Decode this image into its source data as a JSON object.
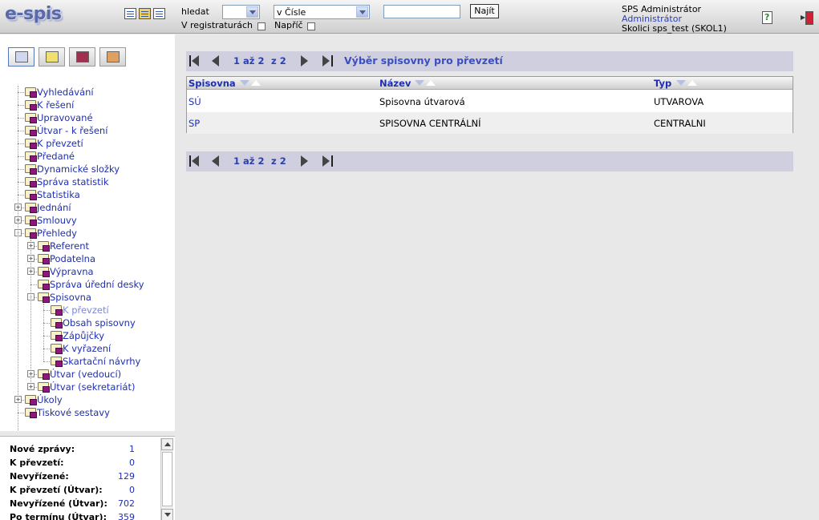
{
  "app": {
    "logo": "e-spis"
  },
  "header": {
    "search_label": "hledat",
    "search_scope_value": "v Čísle",
    "search_type_value": "",
    "search_value": "",
    "search_button": "Najít",
    "in_registers_label": "V registraturách",
    "across_label": "Napříč",
    "user_name": "SPS Administrátor",
    "user_role": "Administrátor",
    "user_training": "Skolici sps_test (SKOL1)",
    "toolbar_icons": [
      "list-icon",
      "form-icon",
      "detail-icon"
    ]
  },
  "left": {
    "tabs": [
      "documents-icon",
      "binder-icon",
      "books-icon",
      "tools-icon"
    ],
    "tree": [
      {
        "label": "Vyhledávání"
      },
      {
        "label": "K řešení"
      },
      {
        "label": "Upravované"
      },
      {
        "label": "Útvar - k řešení"
      },
      {
        "label": "K převzetí"
      },
      {
        "label": "Předané"
      },
      {
        "label": "Dynamické složky"
      },
      {
        "label": "Správa statistik"
      },
      {
        "label": "Statistika"
      },
      {
        "label": "Jednání"
      },
      {
        "label": "Smlouvy"
      },
      {
        "label": "Přehledy"
      },
      {
        "label": "Referent"
      },
      {
        "label": "Podatelna"
      },
      {
        "label": "Výpravna"
      },
      {
        "label": "Správa úřední desky"
      },
      {
        "label": "Spisovna"
      },
      {
        "label": "K převzetí"
      },
      {
        "label": "Obsah spisovny"
      },
      {
        "label": "Zápůjčky"
      },
      {
        "label": "K vyřazení"
      },
      {
        "label": "Skartační návrhy"
      },
      {
        "label": "Útvar (vedoucí)"
      },
      {
        "label": "Útvar (sekretariát)"
      },
      {
        "label": "Úkoly"
      },
      {
        "label": "Tiskové sestavy"
      }
    ],
    "stats": [
      {
        "label": "Nové zprávy:",
        "value": "1"
      },
      {
        "label": "K převzetí:",
        "value": "0"
      },
      {
        "label": "Nevyřízené:",
        "value": "129"
      },
      {
        "label": "K převzetí (Útvar):",
        "value": "0"
      },
      {
        "label": "Nevyřízené (Útvar):",
        "value": "702"
      },
      {
        "label": "Po termínu (Útvar):",
        "value": "359"
      }
    ]
  },
  "main": {
    "pager": {
      "range": "1 až 2",
      "of": "z 2"
    },
    "title": "Výběr spisovny pro převzetí",
    "columns": [
      "Spisovna",
      "Název",
      "Typ"
    ],
    "rows": [
      {
        "code": "SÚ",
        "name": "Spisovna útvarová",
        "type": "UTVAROVA"
      },
      {
        "code": "SP",
        "name": "SPISOVNA CENTRÁLNÍ",
        "type": "CENTRALNI"
      }
    ]
  }
}
